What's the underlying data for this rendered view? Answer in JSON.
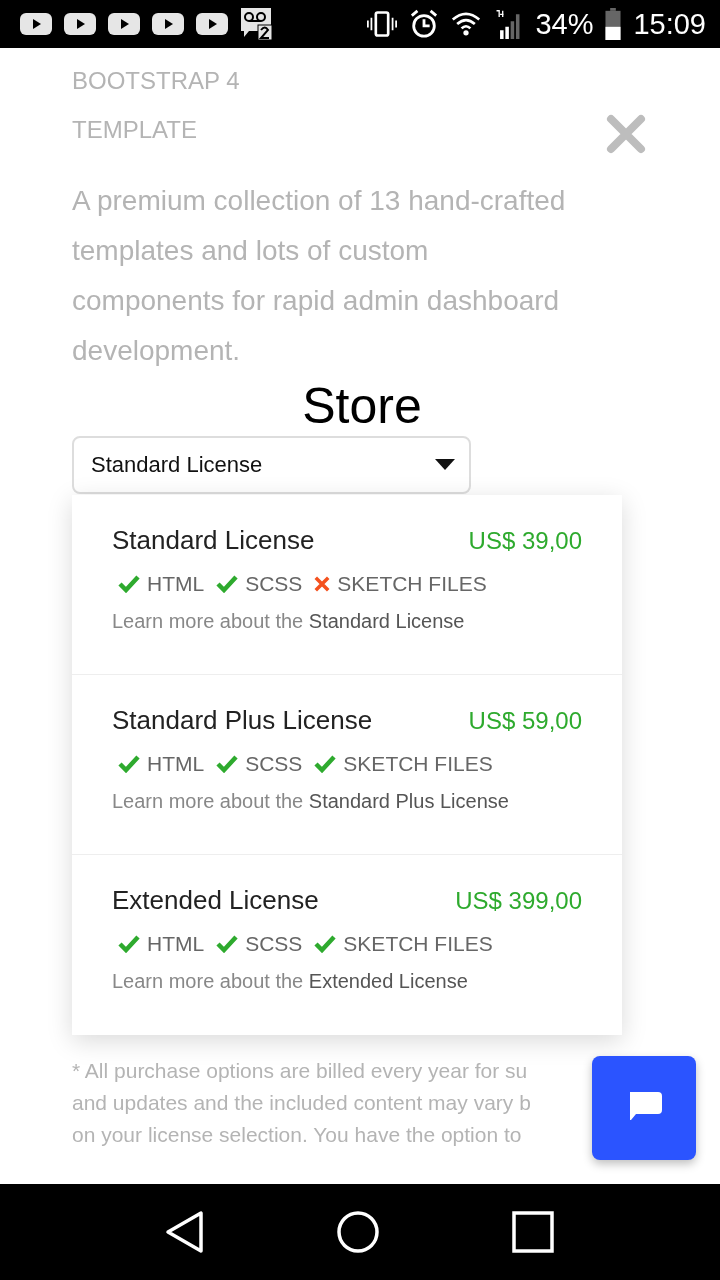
{
  "status_bar": {
    "battery": "34%",
    "time": "15:09"
  },
  "background": {
    "eyebrow": [
      "BOOTSTRAP 4",
      "TEMPLATE"
    ],
    "description": [
      "A premium collection of 13 hand-crafted",
      "templates and lots of custom",
      "components for rapid admin dashboard",
      "development."
    ],
    "footnote": [
      "* All purchase options are billed every year for su",
      "and updates and the included content may vary b",
      "on your license selection. You have the option to"
    ]
  },
  "store": {
    "title": "Store",
    "license_select": {
      "value": "Standard License"
    },
    "licenses": [
      {
        "name": "Standard License",
        "price": "US$ 39,00",
        "features": [
          {
            "label": "HTML",
            "included": true
          },
          {
            "label": "SCSS",
            "included": true
          },
          {
            "label": "SKETCH FILES",
            "included": false
          }
        ],
        "link": "Learn more about the **Standard License**"
      },
      {
        "name": "Standard Plus License",
        "price": "US$ 59,00",
        "features": [
          {
            "label": "HTML",
            "included": true
          },
          {
            "label": "SCSS",
            "included": true
          },
          {
            "label": "SKETCH FILES",
            "included": true
          }
        ],
        "link": "Learn more about the **Standard Plus License**"
      },
      {
        "name": "Extended License",
        "price": "US$ 399,00",
        "features": [
          {
            "label": "HTML",
            "included": true
          },
          {
            "label": "SCSS",
            "included": true
          },
          {
            "label": "SKETCH FILES",
            "included": true
          }
        ],
        "link": "Learn more about the **Extended License**"
      }
    ]
  }
}
